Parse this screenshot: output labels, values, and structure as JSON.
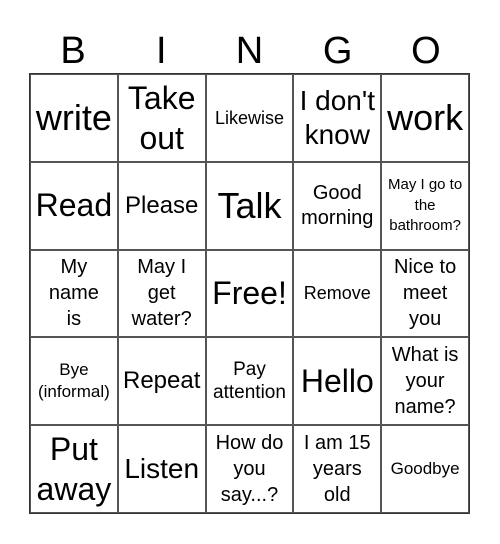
{
  "header": {
    "letters": [
      "B",
      "I",
      "N",
      "G",
      "O"
    ]
  },
  "cells": [
    [
      "write",
      "Take out",
      "Likewise",
      "I don't know",
      "work"
    ],
    [
      "Read",
      "Please",
      "Talk",
      "Good morning",
      "May I go to the bathroom?"
    ],
    [
      "My name is",
      "May I get water?",
      "Free!",
      "Remove",
      "Nice to meet you"
    ],
    [
      "Bye (informal)",
      "Repeat",
      "Pay attention",
      "Hello",
      "What is your name?"
    ],
    [
      "Put away",
      "Listen",
      "How do you say...?",
      "I am 15 years old",
      "Goodbye"
    ]
  ]
}
